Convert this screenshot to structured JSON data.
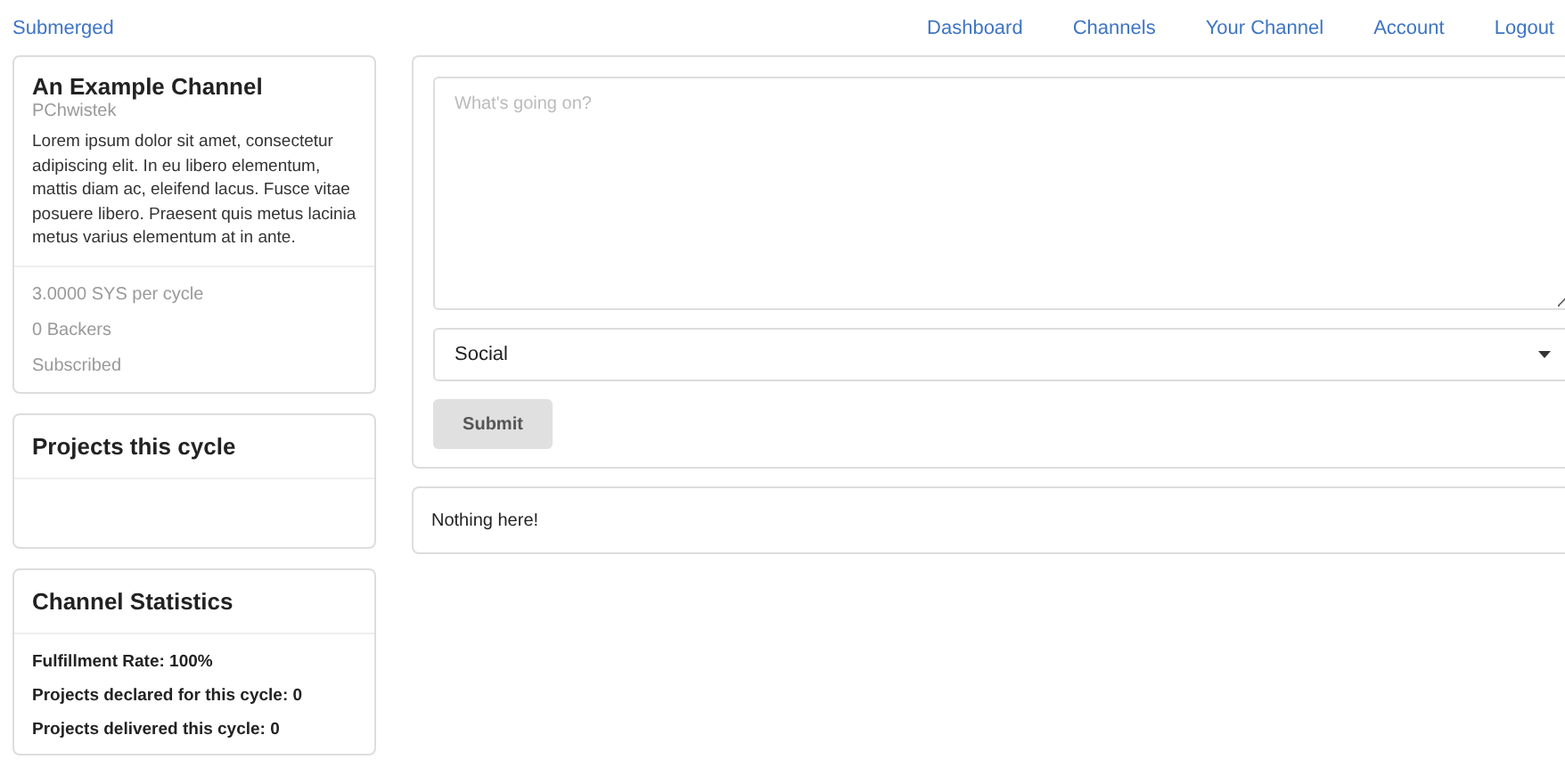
{
  "nav": {
    "brand": "Submerged",
    "links": [
      "Dashboard",
      "Channels",
      "Your Channel",
      "Account",
      "Logout"
    ]
  },
  "channel": {
    "title": "An Example Channel",
    "owner": "PChwistek",
    "description": "Lorem ipsum dolor sit amet, consectetur adipiscing elit. In eu libero elementum, mattis diam ac, eleifend lacus. Fusce vitae posuere libero. Praesent quis metus lacinia metus varius elementum at in ante.",
    "facts": [
      "3.0000 SYS per cycle",
      "0 Backers",
      "Subscribed"
    ]
  },
  "projects": {
    "title": "Projects this cycle"
  },
  "statistics": {
    "title": "Channel Statistics",
    "lines": [
      "Fulfillment Rate: 100%",
      "Projects declared for this cycle: 0",
      "Projects delivered this cycle: 0"
    ]
  },
  "post_form": {
    "placeholder": "What's going on?",
    "category": "Social",
    "submit": "Submit"
  },
  "feed": {
    "empty_message": "Nothing here!"
  }
}
